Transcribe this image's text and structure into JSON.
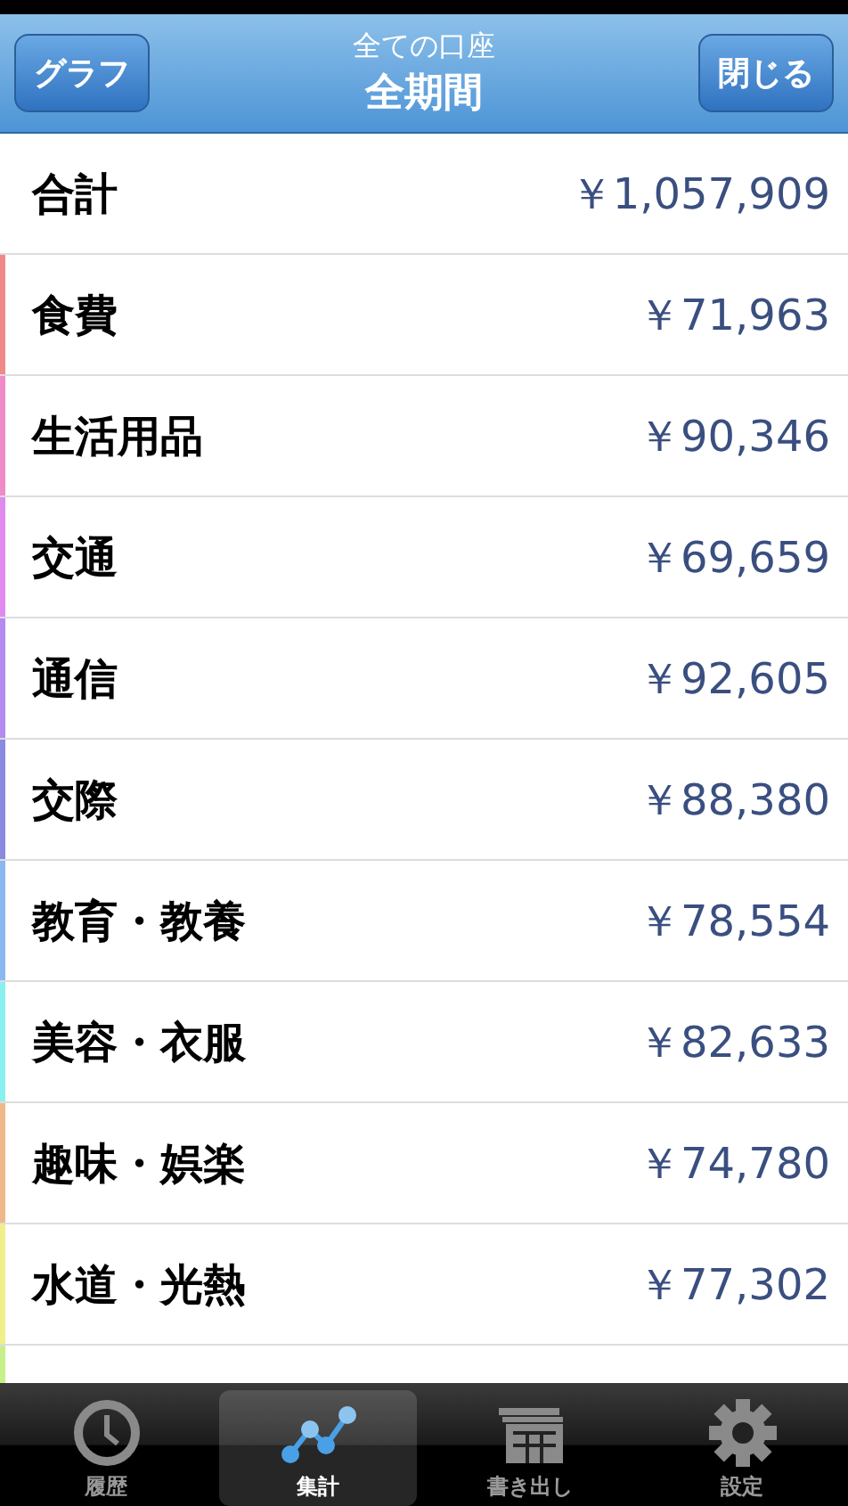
{
  "nav": {
    "left_button": "グラフ",
    "subtitle": "全ての口座",
    "title": "全期間",
    "right_button": "閉じる"
  },
  "total": {
    "label": "合計",
    "amount": "￥1,057,909"
  },
  "rows": [
    {
      "label": "食費",
      "amount": "￥71,963",
      "color": "#f08a8a"
    },
    {
      "label": "生活用品",
      "amount": "￥90,346",
      "color": "#f08ac8"
    },
    {
      "label": "交通",
      "amount": "￥69,659",
      "color": "#e08af0"
    },
    {
      "label": "通信",
      "amount": "￥92,605",
      "color": "#b48af0"
    },
    {
      "label": "交際",
      "amount": "￥88,380",
      "color": "#8a8ae0"
    },
    {
      "label": "教育・教養",
      "amount": "￥78,554",
      "color": "#8ab8f0"
    },
    {
      "label": "美容・衣服",
      "amount": "￥82,633",
      "color": "#8af0f0"
    },
    {
      "label": "趣味・娯楽",
      "amount": "￥74,780",
      "color": "#f0b88a"
    },
    {
      "label": "水道・光熱",
      "amount": "￥77,302",
      "color": "#f0f08a"
    }
  ],
  "partial_row": {
    "color": "#c8f08a"
  },
  "tabs": [
    {
      "label": "履歴",
      "kind": "clock",
      "selected": false
    },
    {
      "label": "集計",
      "kind": "chart",
      "selected": true
    },
    {
      "label": "書き出し",
      "kind": "export",
      "selected": false
    },
    {
      "label": "設定",
      "kind": "gear",
      "selected": false
    }
  ]
}
